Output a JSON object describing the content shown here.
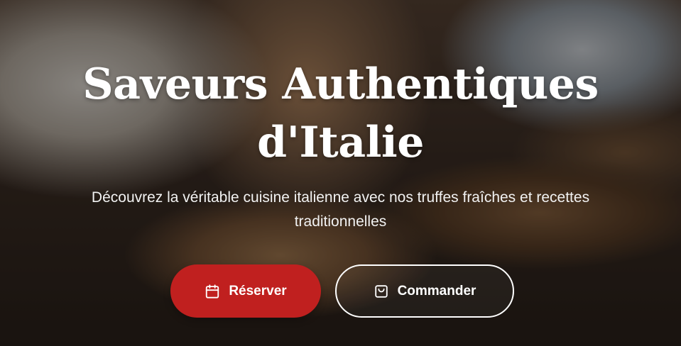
{
  "hero": {
    "title": "Saveurs Authentiques d'Italie",
    "subtitle": "Découvrez la véritable cuisine italienne avec nos truffes fraîches et recettes traditionnelles",
    "background_image": "chef plating truffle dishes on wooden slices"
  },
  "actions": {
    "reserve": {
      "label": "Réserver",
      "icon": "calendar-icon"
    },
    "order": {
      "label": "Commander",
      "icon": "shopping-bag-icon"
    }
  },
  "colors": {
    "primary": "#c0201f",
    "text": "#ffffff"
  }
}
